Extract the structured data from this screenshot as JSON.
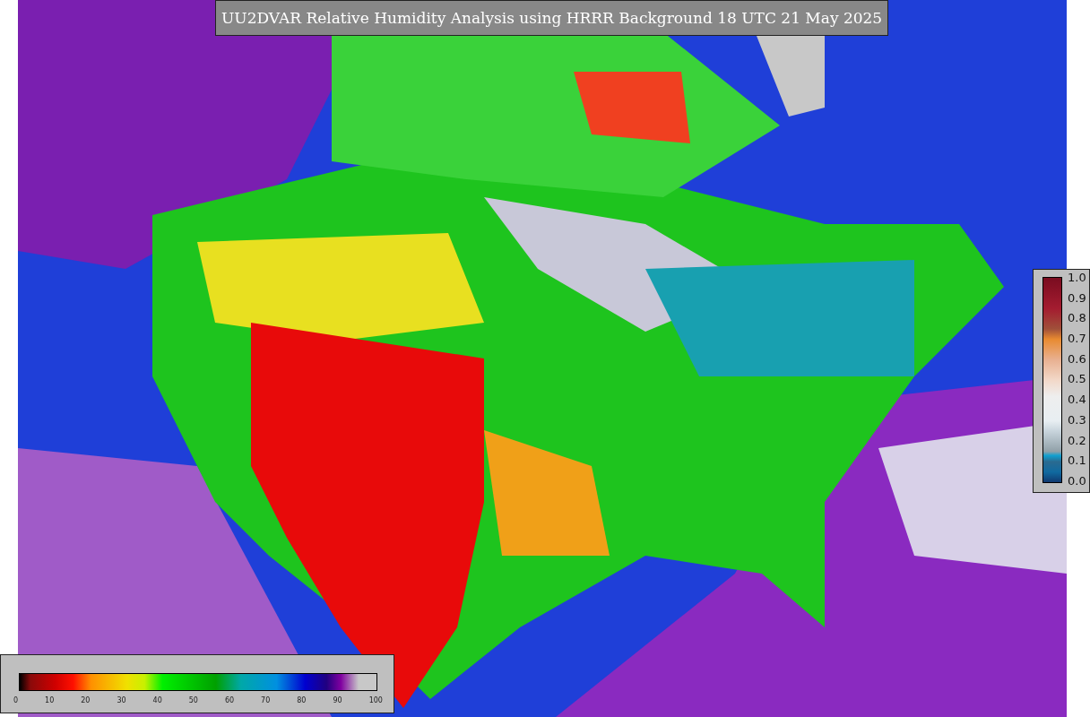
{
  "title": "UU2DVAR Relative Humidity Analysis using HRRR Background 18 UTC 21 May 2025",
  "humidity_legend": {
    "ticks": [
      "0",
      "10",
      "20",
      "30",
      "40",
      "50",
      "60",
      "70",
      "80",
      "90",
      "100"
    ]
  },
  "ratio_legend": {
    "ticks": [
      "1.0",
      "0.9",
      "0.8",
      "0.7",
      "0.6",
      "0.5",
      "0.4",
      "0.3",
      "0.2",
      "0.1",
      "0.0"
    ]
  }
}
